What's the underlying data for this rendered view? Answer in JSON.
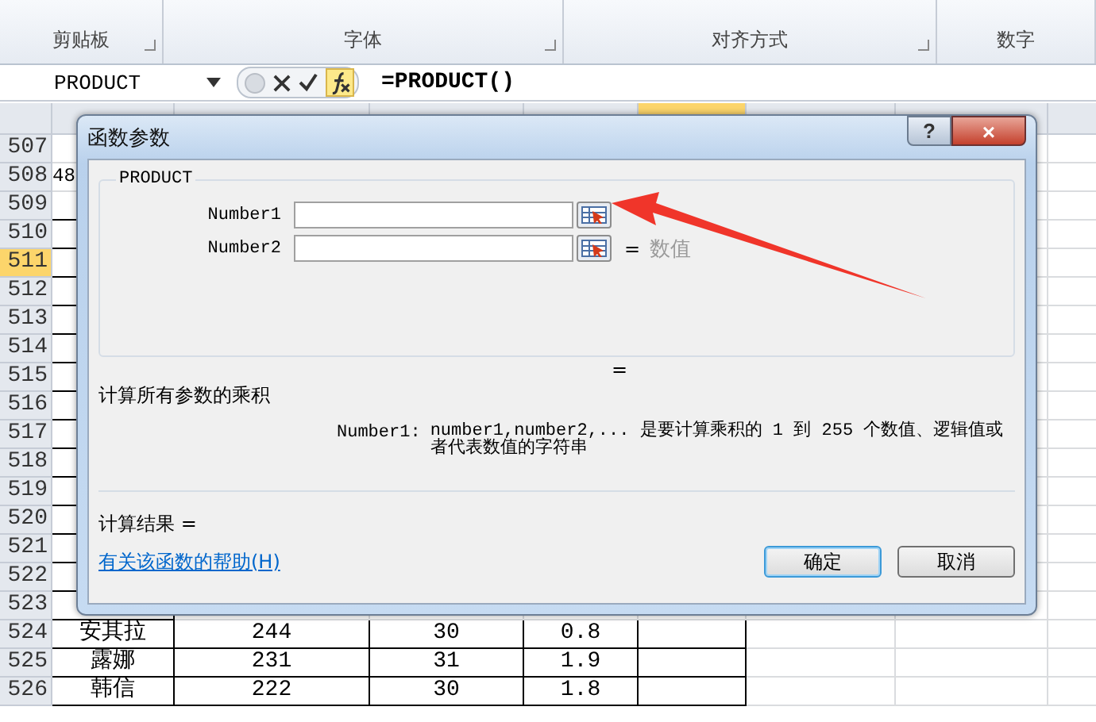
{
  "ribbon_groups": [
    {
      "label": "剪贴板"
    },
    {
      "label": "字体"
    },
    {
      "label": "对齐方式"
    },
    {
      "label": "数字"
    }
  ],
  "formula_bar": {
    "name_box": "PRODUCT",
    "formula": "=PRODUCT()"
  },
  "sheet": {
    "columns": [
      {
        "selected": false
      },
      {
        "selected": false
      },
      {
        "selected": false
      },
      {
        "selected": false
      },
      {
        "selected": true
      },
      {
        "selected": false
      },
      {
        "selected": false
      },
      {
        "selected": false
      }
    ],
    "rows": [
      {
        "number": "507",
        "selected": false,
        "bordered": false,
        "cells": []
      },
      {
        "number": "508",
        "selected": false,
        "bordered": false,
        "cells": [
          "48"
        ]
      },
      {
        "number": "509",
        "selected": false,
        "bordered": true,
        "cells": []
      },
      {
        "number": "510",
        "selected": false,
        "bordered": true,
        "cells": []
      },
      {
        "number": "511",
        "selected": true,
        "bordered": true,
        "cells": []
      },
      {
        "number": "512",
        "selected": false,
        "bordered": true,
        "cells": []
      },
      {
        "number": "513",
        "selected": false,
        "bordered": true,
        "cells": []
      },
      {
        "number": "514",
        "selected": false,
        "bordered": true,
        "cells": []
      },
      {
        "number": "515",
        "selected": false,
        "bordered": true,
        "cells": []
      },
      {
        "number": "516",
        "selected": false,
        "bordered": true,
        "cells": []
      },
      {
        "number": "517",
        "selected": false,
        "bordered": true,
        "cells": []
      },
      {
        "number": "518",
        "selected": false,
        "bordered": true,
        "cells": []
      },
      {
        "number": "519",
        "selected": false,
        "bordered": true,
        "cells": []
      },
      {
        "number": "520",
        "selected": false,
        "bordered": true,
        "cells": []
      },
      {
        "number": "521",
        "selected": false,
        "bordered": true,
        "cells": []
      },
      {
        "number": "522",
        "selected": false,
        "bordered": true,
        "cells": []
      },
      {
        "number": "523",
        "selected": false,
        "bordered": true,
        "cells": []
      },
      {
        "number": "524",
        "selected": false,
        "bordered": true,
        "cells": [
          "安其拉",
          "244",
          "30",
          "0.8",
          ""
        ]
      },
      {
        "number": "525",
        "selected": false,
        "bordered": true,
        "cells": [
          "露娜",
          "231",
          "31",
          "1.9",
          ""
        ]
      },
      {
        "number": "526",
        "selected": false,
        "bordered": true,
        "cells": [
          "韩信",
          "222",
          "30",
          "1.8",
          ""
        ]
      }
    ]
  },
  "dialog": {
    "title": "函数参数",
    "help_button": "?",
    "close_button": "×",
    "function_name": "PRODUCT",
    "arguments": [
      {
        "name": "Number1"
      },
      {
        "name": "Number2",
        "equals": "=",
        "hint": "数值"
      }
    ],
    "result_equals": "=",
    "description": "计算所有参数的乘积",
    "argument_help": {
      "name": "Number1:",
      "text": "number1,number2,... 是要计算乘积的 1 到 255 个数值、逻辑值或者代表数值的字符串"
    },
    "formula_result": "计算结果 =",
    "help_link": "有关该函数的帮助(H)",
    "buttons": [
      {
        "label": "确定",
        "selected": true
      },
      {
        "label": "取消",
        "selected": false
      }
    ]
  }
}
